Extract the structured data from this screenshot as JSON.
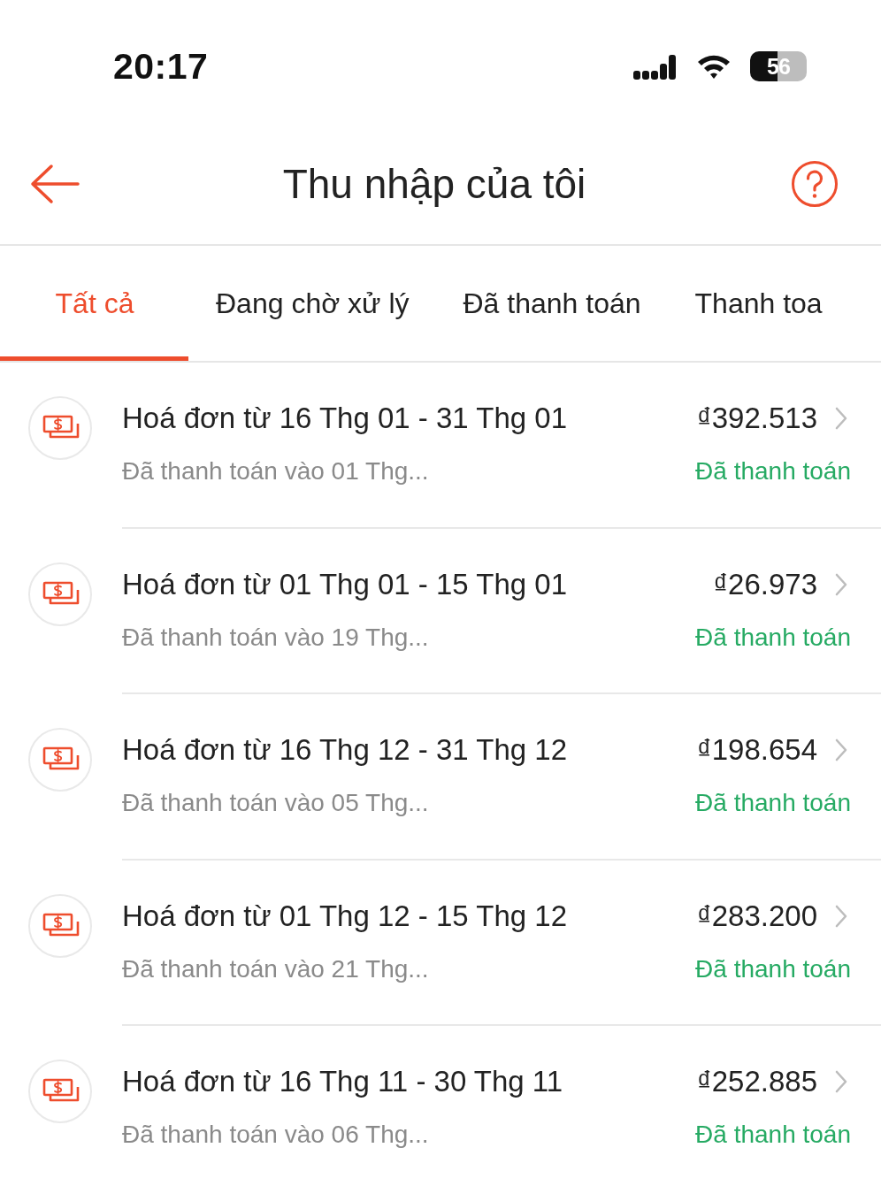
{
  "status_bar": {
    "time": "20:17",
    "battery": "56"
  },
  "header": {
    "title": "Thu nhập của tôi"
  },
  "tabs": [
    {
      "label": "Tất cả",
      "selected": true
    },
    {
      "label": "Đang chờ xử lý",
      "selected": false
    },
    {
      "label": "Đã thanh toán",
      "selected": false
    },
    {
      "label": "Thanh toa",
      "selected": false
    }
  ],
  "invoices": [
    {
      "title": "Hoá đơn từ 16 Thg 01 - 31 Thg 01",
      "subtitle": "Đã thanh toán vào 01 Thg...",
      "amount": "₫392.513",
      "status": "Đã thanh toán"
    },
    {
      "title": "Hoá đơn từ 01 Thg 01 - 15 Thg 01",
      "subtitle": "Đã thanh toán vào 19 Thg...",
      "amount": "₫26.973",
      "status": "Đã thanh toán"
    },
    {
      "title": "Hoá đơn từ 16 Thg 12 - 31 Thg 12",
      "subtitle": "Đã thanh toán vào 05 Thg...",
      "amount": "₫198.654",
      "status": "Đã thanh toán"
    },
    {
      "title": "Hoá đơn từ 01 Thg 12 - 15 Thg 12",
      "subtitle": "Đã thanh toán vào 21 Thg...",
      "amount": "₫283.200",
      "status": "Đã thanh toán"
    },
    {
      "title": "Hoá đơn từ 16 Thg 11 - 30 Thg 11",
      "subtitle": "Đã thanh toán vào 06 Thg...",
      "amount": "₫252.885",
      "status": "Đã thanh toán"
    }
  ]
}
